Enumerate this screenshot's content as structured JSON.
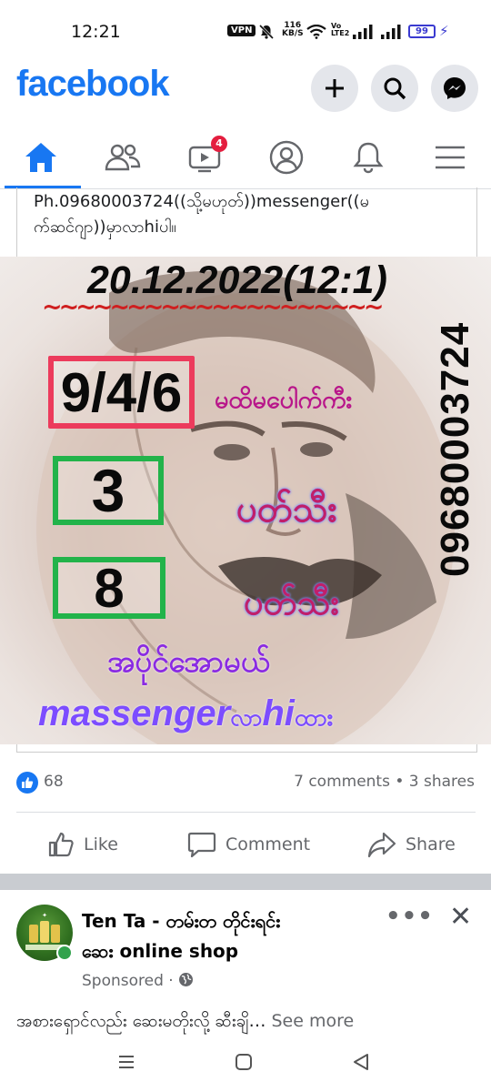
{
  "status_bar": {
    "time": "12:21",
    "vpn": "VPN",
    "net_speed_value": "116",
    "net_speed_unit": "KB/S",
    "volte_top": "Vo",
    "volte_bottom": "LTE2",
    "battery": "99"
  },
  "header": {
    "logo": "facebook",
    "logo_color": "#1877f2",
    "buttons": [
      "plus-icon",
      "search-icon",
      "messenger-icon"
    ]
  },
  "nav": {
    "tabs": [
      "home",
      "friends",
      "watch",
      "profile",
      "notifications",
      "menu"
    ],
    "active_tab": "home",
    "watch_badge": "4"
  },
  "post": {
    "text_line1": "Ph.09680003724((သို့မဟုတ်))messenger((မ",
    "text_line2": "က်ဆင်ဂျာ))မှာလာhiပါ။",
    "image": {
      "date": "20.12.2022(12:1)",
      "tilde_row": "~~~~~~~~~~~~~~~~~~~~",
      "phone": "09680003724",
      "box1": "9/4/6",
      "box1_label": "မထိမပေါက်ကီး",
      "box2": "3",
      "box2_label": "ပတ်သီး",
      "box3": "8",
      "box3_label": "ပတ်သီး",
      "footer_line1": "အပိုင်အောမယ်",
      "footer_massenger": "massenger",
      "footer_la": "လာ",
      "footer_hi": "hi",
      "footer_hta": "ထား"
    },
    "likes": "68",
    "comments_shares": "7 comments • 3 shares",
    "actions": {
      "like": "Like",
      "comment": "Comment",
      "share": "Share"
    }
  },
  "sponsored_post": {
    "name_line1": "Ten Ta - တမ်းတ တိုင်းရင်း",
    "name_line2": "ဆေး online shop",
    "sponsored": "Sponsored ·",
    "text": "အစားရှောင်လည်း ဆေးမတိုးလို့ ဆီးချိ…",
    "see_more": "See more"
  }
}
